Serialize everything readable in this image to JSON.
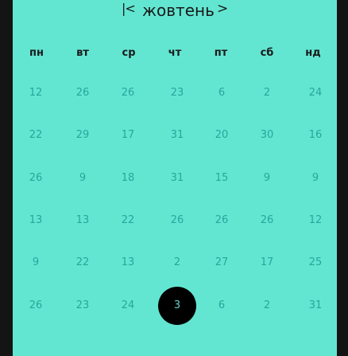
{
  "header": {
    "first_icon": "|<",
    "month": "жовтень",
    "next_icon": ">"
  },
  "weekdays": [
    "пн",
    "вт",
    "ср",
    "чт",
    "пт",
    "сб",
    "нд"
  ],
  "weeks": [
    [
      "12",
      "26",
      "26",
      "23",
      "6",
      "2",
      "24"
    ],
    [
      "22",
      "29",
      "17",
      "31",
      "20",
      "30",
      "16"
    ],
    [
      "26",
      "9",
      "18",
      "31",
      "15",
      "9",
      "9"
    ],
    [
      "13",
      "13",
      "22",
      "26",
      "26",
      "26",
      "12"
    ],
    [
      "9",
      "22",
      "13",
      "2",
      "27",
      "17",
      "25"
    ],
    [
      "26",
      "23",
      "24",
      "3",
      "6",
      "2",
      "31"
    ]
  ],
  "selected": {
    "week": 5,
    "day": 3
  },
  "colors": {
    "background": "#62e6d2",
    "frame": "#141414",
    "day_text": "#2aa59a",
    "selected_bg": "#000000"
  }
}
